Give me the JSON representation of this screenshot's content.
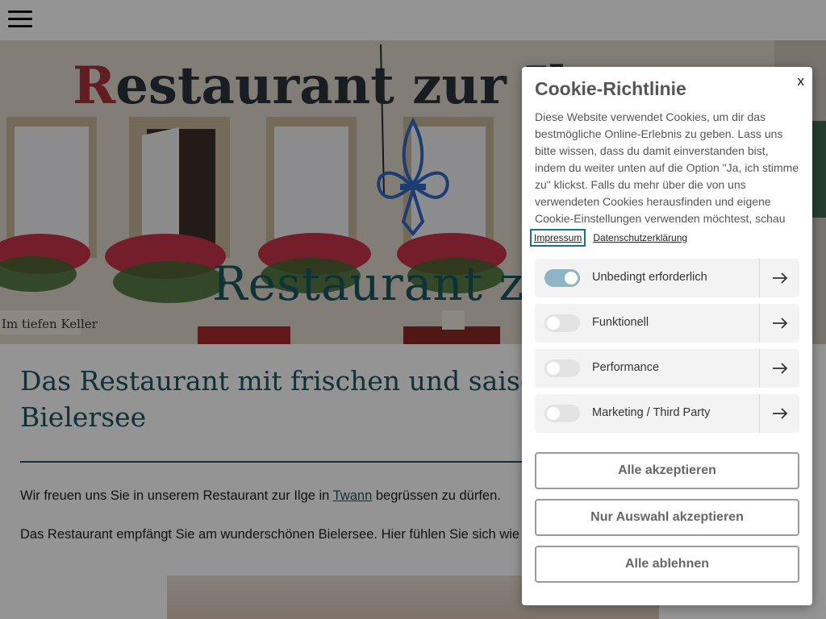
{
  "header": {
    "menu_icon": "hamburger-icon"
  },
  "hero": {
    "sign_text": "Restaurant zur Ilge",
    "side_sign_text": "Im tiefen Keller",
    "overlay_title": "Restaurant zur Ilge",
    "emblem_icon": "fleur-de-lis-icon"
  },
  "main": {
    "headline": "Das Restaurant mit frischen und saisonalen Produkten am Bielersee",
    "intro_before": "Wir freuen uns Sie in unserem Restaurant zur Ilge in ",
    "intro_link": "Twann",
    "intro_after": " begrüssen zu dürfen.",
    "second_para": "Das Restaurant empfängt Sie am wunderschönen Bielersee. Hier fühlen Sie sich wie zu Hause."
  },
  "cookie": {
    "close_label": "x",
    "title": "Cookie-Richtlinie",
    "description": "Diese Website verwendet Cookies, um dir das bestmögliche Online-Erlebnis zu geben. Lass uns bitte wissen, dass du damit einverstanden bist, indem du weiter unten auf die Option \"Ja, ich stimme zu\" klickst. Falls du mehr über die von uns verwendeten Cookies herausfinden und eigene Cookie-Einstellungen verwenden möchtest, schau",
    "links": {
      "impressum": "Impressum",
      "privacy": "Datenschutzerklärung"
    },
    "categories": [
      {
        "label": "Unbedingt erforderlich",
        "enabled": true
      },
      {
        "label": "Funktionell",
        "enabled": false
      },
      {
        "label": "Performance",
        "enabled": false
      },
      {
        "label": "Marketing / Third Party",
        "enabled": false
      }
    ],
    "buttons": {
      "accept_all": "Alle akzeptieren",
      "accept_selection": "Nur Auswahl akzeptieren",
      "reject_all": "Alle ablehnen"
    }
  },
  "colors": {
    "brand": "#1a5560",
    "toggle_on": "#8fb4c6",
    "overlay": "rgba(0,0,0,0.42)"
  }
}
